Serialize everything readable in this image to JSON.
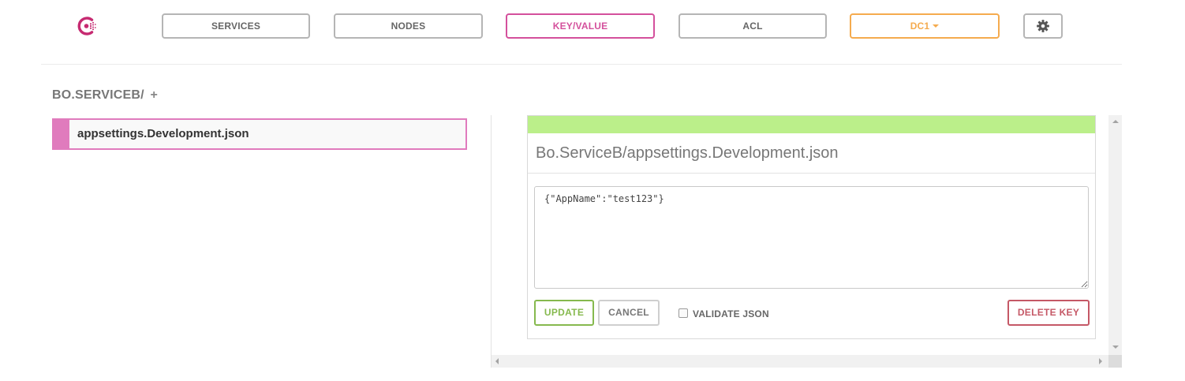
{
  "nav": {
    "services": "SERVICES",
    "nodes": "NODES",
    "key_value": "KEY/VALUE",
    "acl": "ACL",
    "datacenter": "DC1",
    "settings_icon": "gear-icon",
    "logo_icon": "consul-logo-icon"
  },
  "breadcrumb": {
    "path": "BO.SERVICEB/",
    "add": "+"
  },
  "keys": [
    {
      "label": "appsettings.Development.json"
    }
  ],
  "editor": {
    "title": "Bo.ServiceB/appsettings.Development.json",
    "value": "{\"AppName\":\"test123\"}",
    "update_label": "UPDATE",
    "cancel_label": "CANCEL",
    "validate_label": "VALIDATE JSON",
    "validate_checked": false,
    "delete_label": "DELETE KEY"
  },
  "colors": {
    "brand_pink": "#d4509c",
    "dc_orange": "#f5ab4e",
    "status_green": "#bbef8a",
    "update_green": "#86b94e",
    "delete_red": "#c55866"
  }
}
